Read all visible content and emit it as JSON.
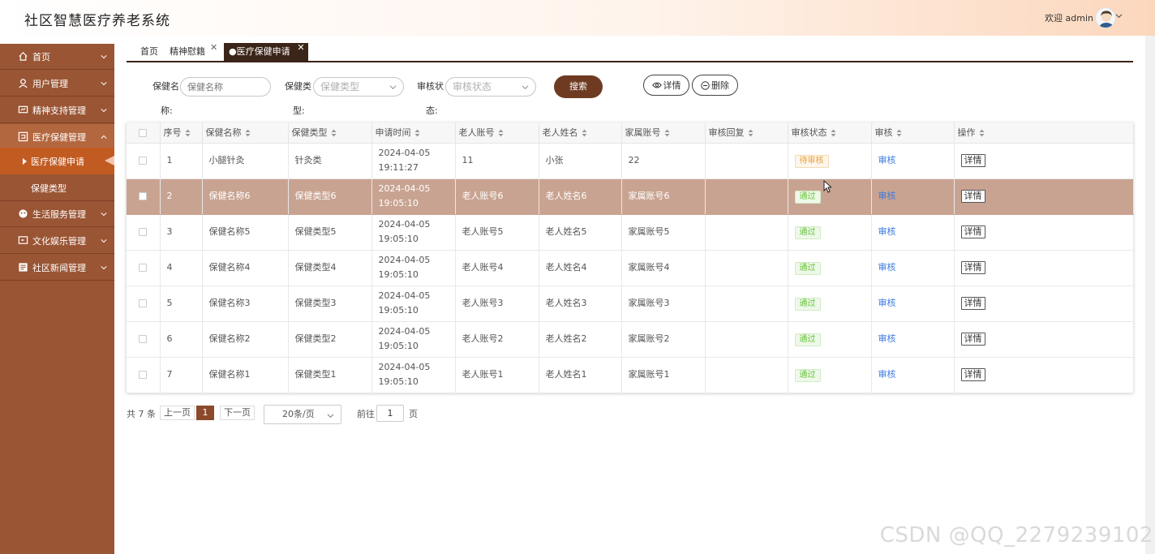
{
  "header": {
    "title": "社区智慧医疗养老系统",
    "welcome": "欢迎 admin"
  },
  "sidebar": {
    "items": [
      {
        "label": "首页",
        "icon": "home-icon"
      },
      {
        "label": "用户管理",
        "icon": "user-icon"
      },
      {
        "label": "精神支持管理",
        "icon": "monitor-icon"
      },
      {
        "label": "医疗保健管理",
        "icon": "medical-icon"
      },
      {
        "label": "生活服务管理",
        "icon": "service-icon"
      },
      {
        "label": "文化娱乐管理",
        "icon": "entertainment-icon"
      },
      {
        "label": "社区新闻管理",
        "icon": "news-icon"
      }
    ],
    "subitems": [
      {
        "label": "医疗保健申请",
        "active": true
      },
      {
        "label": "保健类型",
        "active": false
      }
    ]
  },
  "tabs": [
    {
      "label": "首页"
    },
    {
      "label": "精神慰籍"
    },
    {
      "label": "●医疗保健申请"
    }
  ],
  "search": {
    "name_label_a": "保健名",
    "name_label_b": "称:",
    "name_placeholder": "保健名称",
    "type_label_a": "保健类",
    "type_label_b": "型:",
    "type_placeholder": "保健类型",
    "status_label_a": "审核状",
    "status_label_b": "态:",
    "status_placeholder": "审核状态",
    "search_button": "搜索",
    "detail_button": "详情",
    "delete_button": "删除"
  },
  "table": {
    "columns": [
      "序号",
      "保健名称",
      "保健类型",
      "申请时间",
      "老人账号",
      "老人姓名",
      "家属账号",
      "审核回复",
      "审核状态",
      "审核",
      "操作"
    ],
    "rows": [
      {
        "no": "1",
        "name": "小腿针灸",
        "type": "针灸类",
        "time": "2024-04-05 19:11:27",
        "account": "11",
        "elder": "小张",
        "family": "22",
        "reply": "",
        "status": "待审核",
        "audit": "审核",
        "action": "详情"
      },
      {
        "no": "2",
        "name": "保健名称6",
        "type": "保健类型6",
        "time": "2024-04-05 19:05:10",
        "account": "老人账号6",
        "elder": "老人姓名6",
        "family": "家属账号6",
        "reply": "",
        "status": "通过",
        "audit": "审核",
        "action": "详情"
      },
      {
        "no": "3",
        "name": "保健名称5",
        "type": "保健类型5",
        "time": "2024-04-05 19:05:10",
        "account": "老人账号5",
        "elder": "老人姓名5",
        "family": "家属账号5",
        "reply": "",
        "status": "通过",
        "audit": "审核",
        "action": "详情"
      },
      {
        "no": "4",
        "name": "保健名称4",
        "type": "保健类型4",
        "time": "2024-04-05 19:05:10",
        "account": "老人账号4",
        "elder": "老人姓名4",
        "family": "家属账号4",
        "reply": "",
        "status": "通过",
        "audit": "审核",
        "action": "详情"
      },
      {
        "no": "5",
        "name": "保健名称3",
        "type": "保健类型3",
        "time": "2024-04-05 19:05:10",
        "account": "老人账号3",
        "elder": "老人姓名3",
        "family": "家属账号3",
        "reply": "",
        "status": "通过",
        "audit": "审核",
        "action": "详情"
      },
      {
        "no": "6",
        "name": "保健名称2",
        "type": "保健类型2",
        "time": "2024-04-05 19:05:10",
        "account": "老人账号2",
        "elder": "老人姓名2",
        "family": "家属账号2",
        "reply": "",
        "status": "通过",
        "audit": "审核",
        "action": "详情"
      },
      {
        "no": "7",
        "name": "保健名称1",
        "type": "保健类型1",
        "time": "2024-04-05 19:05:10",
        "account": "老人账号1",
        "elder": "老人姓名1",
        "family": "家属账号1",
        "reply": "",
        "status": "通过",
        "audit": "审核",
        "action": "详情"
      }
    ]
  },
  "pagination": {
    "total": "共 7 条",
    "prev": "上一页",
    "current": "1",
    "next": "下一页",
    "page_size": "20条/页",
    "goto_label": "前往",
    "goto_value": "1",
    "page_unit": "页"
  },
  "watermark": "CSDN @QQ_2279239102",
  "colors": {
    "sidebar": "#9a5534",
    "accent": "#6e3b22",
    "active_submenu": "#c25b22",
    "highlight_row": "#c9a391"
  }
}
